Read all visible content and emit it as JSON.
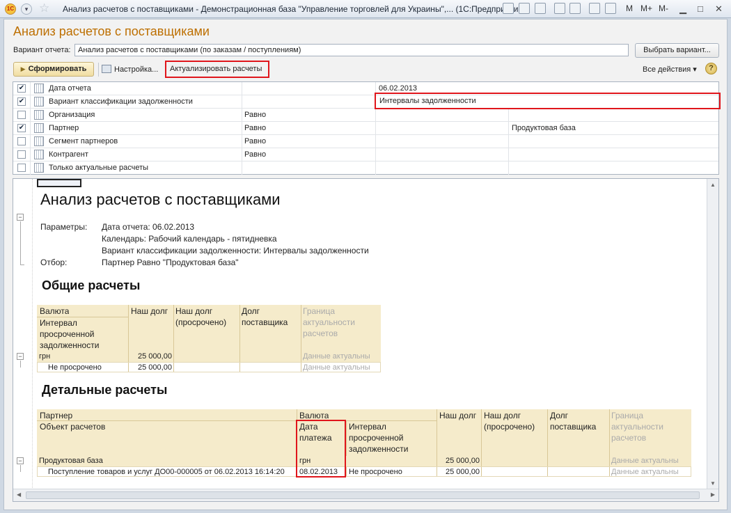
{
  "window": {
    "title": "Анализ расчетов с поставщиками - Демонстрационная база \"Управление торговлей для Украины\",... (1С:Предприятие)",
    "logo": "1С",
    "m_labels": [
      "M",
      "M+",
      "M-"
    ]
  },
  "form": {
    "title": "Анализ расчетов с поставщиками",
    "variant_label": "Вариант отчета:",
    "variant_value": "Анализ расчетов с поставщиками (по заказам / поступлениям)",
    "choose_variant_button": "Выбрать вариант...",
    "generate_button": "Сформировать",
    "settings_button": "Настройка...",
    "actualize_button": "Актуализировать расчеты",
    "all_actions": "Все действия ▾",
    "help": "?"
  },
  "settings_rows": [
    {
      "checked": true,
      "name": "Дата отчета",
      "condition": "",
      "value1": "06.02.2013",
      "value2": ""
    },
    {
      "checked": true,
      "name": "Вариант классификации задолженности",
      "condition": "",
      "value1": "Интервалы задолженности",
      "value2": ""
    },
    {
      "checked": false,
      "name": "Организация",
      "condition": "Равно",
      "value1": "",
      "value2": ""
    },
    {
      "checked": true,
      "name": "Партнер",
      "condition": "Равно",
      "value1": "",
      "value2": "Продуктовая база"
    },
    {
      "checked": false,
      "name": "Сегмент партнеров",
      "condition": "Равно",
      "value1": "",
      "value2": ""
    },
    {
      "checked": false,
      "name": "Контрагент",
      "condition": "Равно",
      "value1": "",
      "value2": ""
    },
    {
      "checked": false,
      "name": "Только актуальные расчеты",
      "condition": "",
      "value1": "",
      "value2": ""
    }
  ],
  "report": {
    "title": "Анализ расчетов с поставщиками",
    "params_label": "Параметры:",
    "params": [
      "Дата отчета: 06.02.2013",
      "Календарь: Рабочий календарь - пятидневка",
      "Вариант классификации задолженности: Интервалы задолженности"
    ],
    "filter_label": "Отбор:",
    "filter": "Партнер Равно \"Продуктовая база\"",
    "general": {
      "heading": "Общие расчеты",
      "headers": {
        "currency": "Валюта",
        "interval": "Интервал просроченной задолженности",
        "our_debt": "Наш долг",
        "overdue": "Наш долг (просрочено)",
        "supplier_debt": "Долг поставщика",
        "border": "Граница актуальности расчетов"
      },
      "rows": [
        {
          "label": "грн",
          "our_debt": "25 000,00",
          "border": "Данные актуальны"
        },
        {
          "label": "Не просрочено",
          "our_debt": "25 000,00",
          "border": "Данные актуальны"
        }
      ]
    },
    "detailed": {
      "heading": "Детальные расчеты",
      "headers": {
        "partner": "Партнер",
        "object": "Объект расчетов",
        "currency": "Валюта",
        "pay_date": "Дата платежа",
        "interval": "Интервал просроченной задолженности",
        "our_debt": "Наш долг",
        "overdue": "Наш долг (просрочено)",
        "supplier_debt": "Долг поставщика",
        "border": "Граница актуальности расчетов"
      },
      "rows": [
        {
          "label": "Продуктовая база",
          "currency": "грн",
          "interval": "",
          "our_debt": "25 000,00",
          "border": "Данные актуальны"
        },
        {
          "label": "Поступление товаров и услуг ДО00-000005 от 06.02.2013 16:14:20",
          "currency": "08.02.2013",
          "interval": "Не просрочено",
          "our_debt": "25 000,00",
          "border": "Данные актуальны"
        }
      ]
    }
  }
}
